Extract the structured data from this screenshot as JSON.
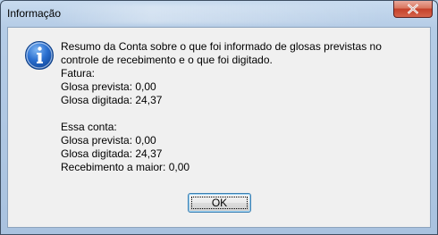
{
  "window": {
    "title": "Informação"
  },
  "icons": {
    "title_close": "close-icon",
    "message": "info-icon"
  },
  "message": {
    "intro": "Resumo da Conta sobre o que foi informado de glosas previstas no controle de recebimento e o que foi digitado.",
    "fatura_header": "Fatura:",
    "fatura_glosa_prevista": "Glosa prevista: 0,00",
    "fatura_glosa_digitada": "Glosa digitada: 24,37",
    "conta_header": "Essa conta:",
    "conta_glosa_prevista": "Glosa prevista: 0,00",
    "conta_glosa_digitada": "Glosa digitada: 24,37",
    "conta_recebimento_maior": "Recebimento a maior: 0,00"
  },
  "buttons": {
    "ok_label": "OK"
  },
  "colors": {
    "frame": "#b5cce6",
    "client_bg": "#f0f0f0",
    "close_red": "#c4412a",
    "info_blue": "#1f5fbf"
  }
}
